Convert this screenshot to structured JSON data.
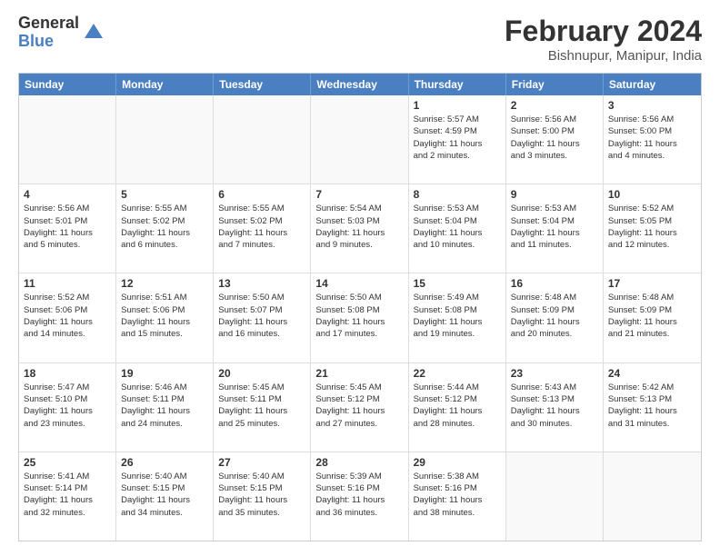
{
  "logo": {
    "general": "General",
    "blue": "Blue"
  },
  "title": "February 2024",
  "location": "Bishnupur, Manipur, India",
  "header_days": [
    "Sunday",
    "Monday",
    "Tuesday",
    "Wednesday",
    "Thursday",
    "Friday",
    "Saturday"
  ],
  "weeks": [
    [
      {
        "day": "",
        "info": ""
      },
      {
        "day": "",
        "info": ""
      },
      {
        "day": "",
        "info": ""
      },
      {
        "day": "",
        "info": ""
      },
      {
        "day": "1",
        "info": "Sunrise: 5:57 AM\nSunset: 4:59 PM\nDaylight: 11 hours\nand 2 minutes."
      },
      {
        "day": "2",
        "info": "Sunrise: 5:56 AM\nSunset: 5:00 PM\nDaylight: 11 hours\nand 3 minutes."
      },
      {
        "day": "3",
        "info": "Sunrise: 5:56 AM\nSunset: 5:00 PM\nDaylight: 11 hours\nand 4 minutes."
      }
    ],
    [
      {
        "day": "4",
        "info": "Sunrise: 5:56 AM\nSunset: 5:01 PM\nDaylight: 11 hours\nand 5 minutes."
      },
      {
        "day": "5",
        "info": "Sunrise: 5:55 AM\nSunset: 5:02 PM\nDaylight: 11 hours\nand 6 minutes."
      },
      {
        "day": "6",
        "info": "Sunrise: 5:55 AM\nSunset: 5:02 PM\nDaylight: 11 hours\nand 7 minutes."
      },
      {
        "day": "7",
        "info": "Sunrise: 5:54 AM\nSunset: 5:03 PM\nDaylight: 11 hours\nand 9 minutes."
      },
      {
        "day": "8",
        "info": "Sunrise: 5:53 AM\nSunset: 5:04 PM\nDaylight: 11 hours\nand 10 minutes."
      },
      {
        "day": "9",
        "info": "Sunrise: 5:53 AM\nSunset: 5:04 PM\nDaylight: 11 hours\nand 11 minutes."
      },
      {
        "day": "10",
        "info": "Sunrise: 5:52 AM\nSunset: 5:05 PM\nDaylight: 11 hours\nand 12 minutes."
      }
    ],
    [
      {
        "day": "11",
        "info": "Sunrise: 5:52 AM\nSunset: 5:06 PM\nDaylight: 11 hours\nand 14 minutes."
      },
      {
        "day": "12",
        "info": "Sunrise: 5:51 AM\nSunset: 5:06 PM\nDaylight: 11 hours\nand 15 minutes."
      },
      {
        "day": "13",
        "info": "Sunrise: 5:50 AM\nSunset: 5:07 PM\nDaylight: 11 hours\nand 16 minutes."
      },
      {
        "day": "14",
        "info": "Sunrise: 5:50 AM\nSunset: 5:08 PM\nDaylight: 11 hours\nand 17 minutes."
      },
      {
        "day": "15",
        "info": "Sunrise: 5:49 AM\nSunset: 5:08 PM\nDaylight: 11 hours\nand 19 minutes."
      },
      {
        "day": "16",
        "info": "Sunrise: 5:48 AM\nSunset: 5:09 PM\nDaylight: 11 hours\nand 20 minutes."
      },
      {
        "day": "17",
        "info": "Sunrise: 5:48 AM\nSunset: 5:09 PM\nDaylight: 11 hours\nand 21 minutes."
      }
    ],
    [
      {
        "day": "18",
        "info": "Sunrise: 5:47 AM\nSunset: 5:10 PM\nDaylight: 11 hours\nand 23 minutes."
      },
      {
        "day": "19",
        "info": "Sunrise: 5:46 AM\nSunset: 5:11 PM\nDaylight: 11 hours\nand 24 minutes."
      },
      {
        "day": "20",
        "info": "Sunrise: 5:45 AM\nSunset: 5:11 PM\nDaylight: 11 hours\nand 25 minutes."
      },
      {
        "day": "21",
        "info": "Sunrise: 5:45 AM\nSunset: 5:12 PM\nDaylight: 11 hours\nand 27 minutes."
      },
      {
        "day": "22",
        "info": "Sunrise: 5:44 AM\nSunset: 5:12 PM\nDaylight: 11 hours\nand 28 minutes."
      },
      {
        "day": "23",
        "info": "Sunrise: 5:43 AM\nSunset: 5:13 PM\nDaylight: 11 hours\nand 30 minutes."
      },
      {
        "day": "24",
        "info": "Sunrise: 5:42 AM\nSunset: 5:13 PM\nDaylight: 11 hours\nand 31 minutes."
      }
    ],
    [
      {
        "day": "25",
        "info": "Sunrise: 5:41 AM\nSunset: 5:14 PM\nDaylight: 11 hours\nand 32 minutes."
      },
      {
        "day": "26",
        "info": "Sunrise: 5:40 AM\nSunset: 5:15 PM\nDaylight: 11 hours\nand 34 minutes."
      },
      {
        "day": "27",
        "info": "Sunrise: 5:40 AM\nSunset: 5:15 PM\nDaylight: 11 hours\nand 35 minutes."
      },
      {
        "day": "28",
        "info": "Sunrise: 5:39 AM\nSunset: 5:16 PM\nDaylight: 11 hours\nand 36 minutes."
      },
      {
        "day": "29",
        "info": "Sunrise: 5:38 AM\nSunset: 5:16 PM\nDaylight: 11 hours\nand 38 minutes."
      },
      {
        "day": "",
        "info": ""
      },
      {
        "day": "",
        "info": ""
      }
    ]
  ]
}
